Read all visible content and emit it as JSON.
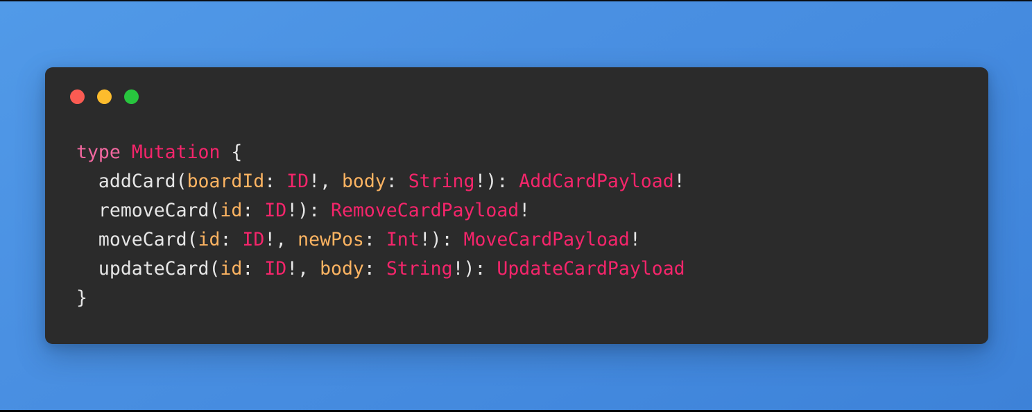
{
  "window": {
    "traffic_lights": [
      {
        "name": "close",
        "color": "#FB5B52"
      },
      {
        "name": "minimize",
        "color": "#FDBC2D"
      },
      {
        "name": "maximize",
        "color": "#28C53E"
      }
    ],
    "background_color": "#2B2B2B",
    "page_background_color": "#4A90E2"
  },
  "theme": {
    "keyword_color": "#F368A0",
    "type_color": "#F5256B",
    "argument_color": "#FDB462",
    "text_color": "#E6E6E6"
  },
  "code": {
    "language": "graphql",
    "lines": [
      {
        "indent": 0,
        "tokens": [
          {
            "text": "type",
            "kind": "keyword"
          },
          {
            "text": " ",
            "kind": "plain"
          },
          {
            "text": "Mutation",
            "kind": "type"
          },
          {
            "text": " {",
            "kind": "punct"
          }
        ]
      },
      {
        "indent": 1,
        "tokens": [
          {
            "text": "addCard(",
            "kind": "plain"
          },
          {
            "text": "boardId",
            "kind": "argument"
          },
          {
            "text": ": ",
            "kind": "punct"
          },
          {
            "text": "ID",
            "kind": "type"
          },
          {
            "text": "!, ",
            "kind": "punct"
          },
          {
            "text": "body",
            "kind": "argument"
          },
          {
            "text": ": ",
            "kind": "punct"
          },
          {
            "text": "String",
            "kind": "type"
          },
          {
            "text": "!): ",
            "kind": "punct"
          },
          {
            "text": "AddCardPayload",
            "kind": "type"
          },
          {
            "text": "!",
            "kind": "punct"
          }
        ]
      },
      {
        "indent": 1,
        "tokens": [
          {
            "text": "removeCard(",
            "kind": "plain"
          },
          {
            "text": "id",
            "kind": "argument"
          },
          {
            "text": ": ",
            "kind": "punct"
          },
          {
            "text": "ID",
            "kind": "type"
          },
          {
            "text": "!): ",
            "kind": "punct"
          },
          {
            "text": "RemoveCardPayload",
            "kind": "type"
          },
          {
            "text": "!",
            "kind": "punct"
          }
        ]
      },
      {
        "indent": 1,
        "tokens": [
          {
            "text": "moveCard(",
            "kind": "plain"
          },
          {
            "text": "id",
            "kind": "argument"
          },
          {
            "text": ": ",
            "kind": "punct"
          },
          {
            "text": "ID",
            "kind": "type"
          },
          {
            "text": "!, ",
            "kind": "punct"
          },
          {
            "text": "newPos",
            "kind": "argument"
          },
          {
            "text": ": ",
            "kind": "punct"
          },
          {
            "text": "Int",
            "kind": "type"
          },
          {
            "text": "!): ",
            "kind": "punct"
          },
          {
            "text": "MoveCardPayload",
            "kind": "type"
          },
          {
            "text": "!",
            "kind": "punct"
          }
        ]
      },
      {
        "indent": 1,
        "tokens": [
          {
            "text": "updateCard(",
            "kind": "plain"
          },
          {
            "text": "id",
            "kind": "argument"
          },
          {
            "text": ": ",
            "kind": "punct"
          },
          {
            "text": "ID",
            "kind": "type"
          },
          {
            "text": "!, ",
            "kind": "punct"
          },
          {
            "text": "body",
            "kind": "argument"
          },
          {
            "text": ": ",
            "kind": "punct"
          },
          {
            "text": "String",
            "kind": "type"
          },
          {
            "text": "!): ",
            "kind": "punct"
          },
          {
            "text": "UpdateCardPayload",
            "kind": "type"
          }
        ]
      },
      {
        "indent": 0,
        "tokens": [
          {
            "text": "}",
            "kind": "punct"
          }
        ]
      }
    ]
  }
}
